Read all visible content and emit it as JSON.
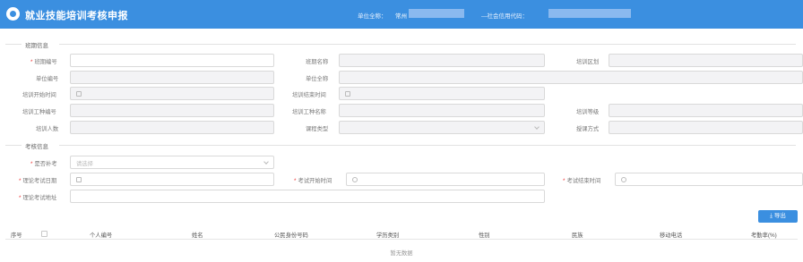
{
  "header": {
    "title": "就业技能培训考核申报",
    "unit_name_label": "单位全称：",
    "unit_name_value": "常州",
    "credit_code_label": "—社会信用代码："
  },
  "section_class": {
    "title": "班期信息"
  },
  "fields": {
    "class_no": "班期编号",
    "class_name": "班期名称",
    "training_district": "培训区划",
    "unit_no": "单位编号",
    "unit_full_name": "单位全称",
    "training_start": "培训开始时间",
    "training_end": "培训结束时间",
    "job_code": "培训工种编号",
    "job_name": "培训工种名称",
    "training_level": "培训等级",
    "trainee_count": "培训人数",
    "course_type": "课程类型",
    "teaching_mode": "授课方式"
  },
  "section_exam": {
    "title": "考核信息"
  },
  "exam": {
    "is_makeup_label": "是否补考",
    "is_makeup_placeholder": "请选择",
    "theory_date_label": "理论考试日期",
    "exam_start_label": "考试开始时间",
    "exam_end_label": "考试结束时间",
    "theory_address_label": "理论考试地址"
  },
  "toolbar": {
    "export_label": "导出"
  },
  "table": {
    "columns": [
      "序号",
      "个人编号",
      "姓名",
      "公民身份号码",
      "学历类别",
      "性别",
      "民族",
      "移动电话",
      "考勤率(%)"
    ],
    "empty_text": "暂无数据"
  }
}
